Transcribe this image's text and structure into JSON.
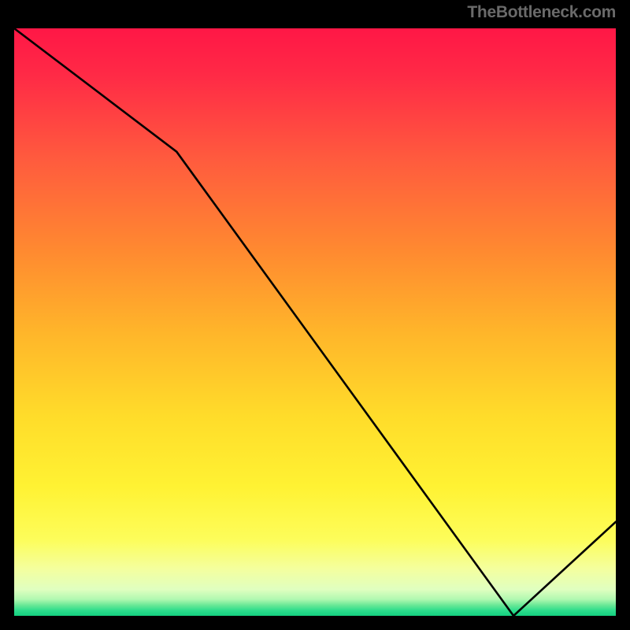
{
  "attribution": "TheBottleneck.com",
  "inline_label": "",
  "chart_data": {
    "type": "line",
    "title": "",
    "xlabel": "",
    "ylabel": "",
    "xlim": [
      0,
      100
    ],
    "ylim": [
      0,
      100
    ],
    "grid": false,
    "legend": false,
    "background": "gradient-red-yellow-green",
    "x": [
      0,
      27,
      83,
      100
    ],
    "values": [
      100,
      79,
      0,
      16
    ],
    "annotations": [
      {
        "x": 78,
        "y": 2,
        "text": ""
      }
    ]
  }
}
